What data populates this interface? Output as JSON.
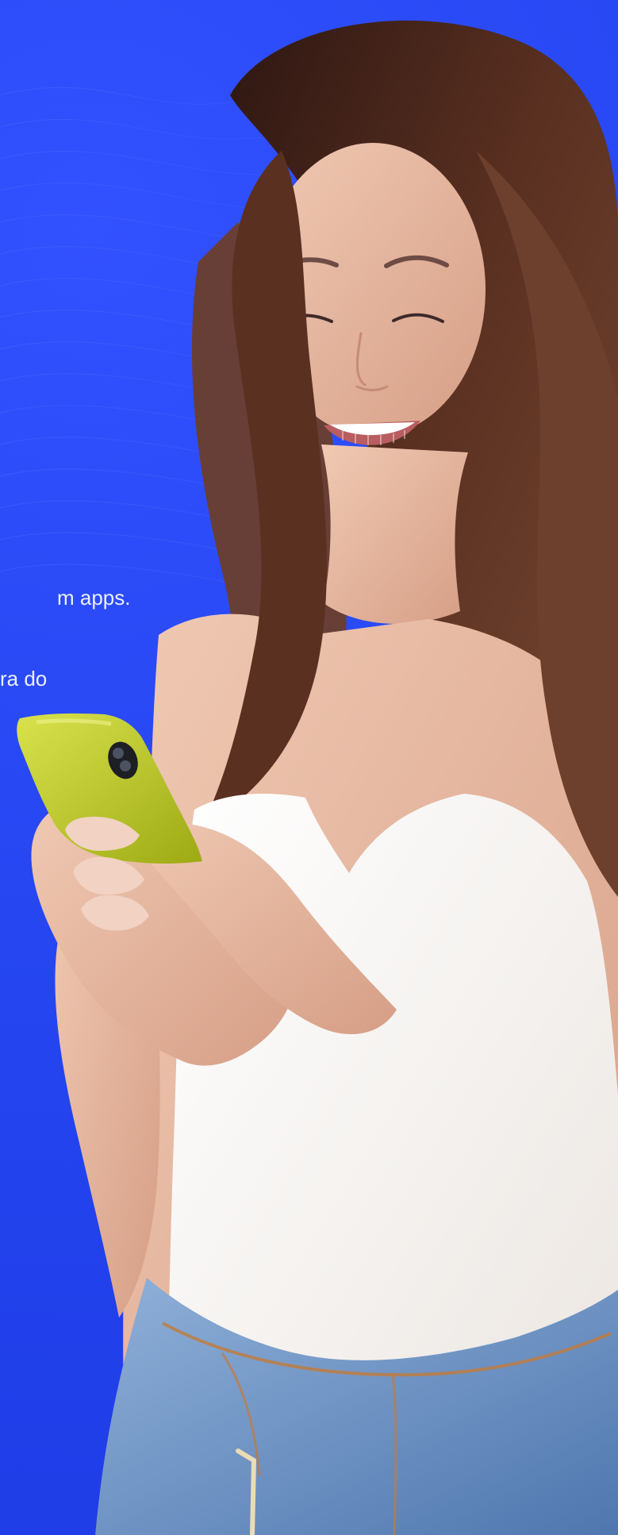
{
  "hero": {
    "text_line_1": "m apps.",
    "text_line_2": "ra do"
  },
  "colors": {
    "background": "#2445F0",
    "hair": "#4B2D22",
    "skin": "#E8B8A0",
    "phone": "#B8C41B",
    "shirt": "#F7F3EF",
    "jeans": "#6E93C4"
  },
  "icons": {
    "phone_icon": "phone-icon"
  }
}
